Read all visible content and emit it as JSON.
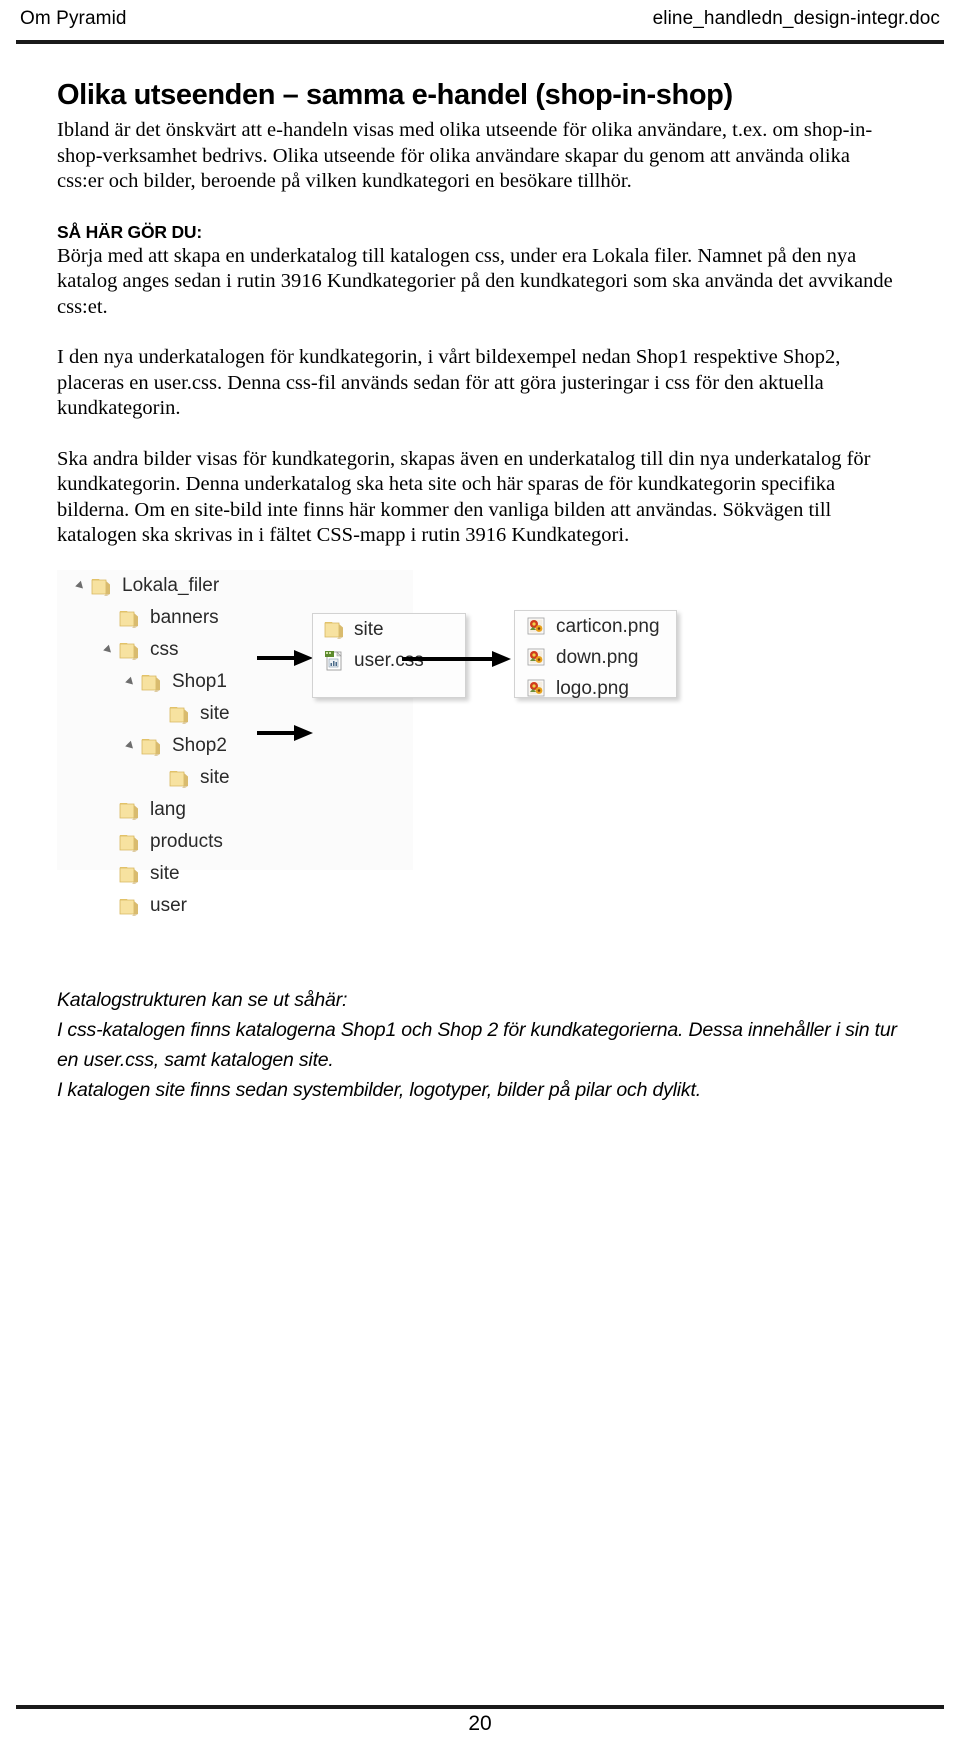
{
  "header": {
    "left_title": "Om Pyramid",
    "right_title": "eline_handledn_design-integr.doc"
  },
  "main": {
    "section_title": "Olika utseenden – samma e-handel (shop-in-shop)",
    "intro_paragraph": "Ibland är det önskvärt att e-handeln visas med olika utseende för olika användare, t.ex. om shop-in-shop-verksamhet bedrivs. Olika utseende för olika användare skapar du genom att använda olika css:er och bilder, beroende på vilken kundkategori en besökare tillhör.",
    "howto_heading": "SÅ HÄR GÖR DU:",
    "howto_paragraph": "Börja med att skapa en underkatalog till katalogen css, under era Lokala filer. Namnet på den nya katalog anges sedan i rutin 3916 Kundkategorier på den kundkategori som ska använda det avvikande css:et.",
    "paragraph_2": "I den nya underkatalogen för kundkategorin, i vårt bildexempel nedan Shop1 respektive Shop2, placeras en user.css. Denna css-fil används sedan för att göra justeringar i css för den aktuella kundkategorin.",
    "paragraph_3": "Ska andra bilder visas för kundkategorin, skapas även en underkatalog till din nya underkatalog för kundkategorin. Denna underkatalog ska heta site och här sparas de för kundkategorin specifika bilderna. Om en site-bild inte finns här kommer den vanliga bilden att användas. Sökvägen till katalogen ska skrivas in i fältet CSS-mapp i rutin 3916 Kundkategori."
  },
  "figure": {
    "tree": [
      {
        "label": "Lokala_filer",
        "indent": 0,
        "expander": true,
        "icon": "folder-icon"
      },
      {
        "label": "banners",
        "indent": 1,
        "expander": false,
        "icon": "folder-icon"
      },
      {
        "label": "css",
        "indent": 1,
        "expander": true,
        "icon": "folder-icon"
      },
      {
        "label": "Shop1",
        "indent": 2,
        "expander": true,
        "icon": "folder-icon"
      },
      {
        "label": "site",
        "indent": 3,
        "expander": false,
        "icon": "folder-icon"
      },
      {
        "label": "Shop2",
        "indent": 2,
        "expander": true,
        "icon": "folder-icon"
      },
      {
        "label": "site",
        "indent": 3,
        "expander": false,
        "icon": "folder-icon"
      },
      {
        "label": "lang",
        "indent": 1,
        "expander": false,
        "icon": "folder-icon"
      },
      {
        "label": "products",
        "indent": 1,
        "expander": false,
        "icon": "folder-icon"
      },
      {
        "label": "site",
        "indent": 1,
        "expander": false,
        "icon": "folder-icon"
      },
      {
        "label": "user",
        "indent": 1,
        "expander": false,
        "icon": "folder-icon"
      }
    ],
    "middle_panel": [
      {
        "label": "site",
        "icon": "folder-icon"
      },
      {
        "label": "user.css",
        "icon": "css-file-icon"
      }
    ],
    "right_panel": [
      {
        "label": "carticon.png",
        "icon": "image-file-icon"
      },
      {
        "label": "down.png",
        "icon": "image-file-icon"
      },
      {
        "label": "logo.png",
        "icon": "image-file-icon"
      }
    ],
    "colors": {
      "folder": "#f5dc96",
      "folder_dark": "#e0c377",
      "panel_bg": "#fbfbfb",
      "panel_border": "#d2d2d2",
      "arrow": "#000000"
    }
  },
  "caption": {
    "line1": "Katalogstrukturen kan se ut såhär:",
    "line2": "I css-katalogen finns katalogerna Shop1 och Shop 2 för kundkategorierna. Dessa innehåller i sin tur",
    "line3": "en user.css, samt katalogen site.",
    "line4": "I katalogen site finns sedan systembilder, logotyper, bilder på pilar och dylikt."
  },
  "footer": {
    "page_number": "20"
  }
}
